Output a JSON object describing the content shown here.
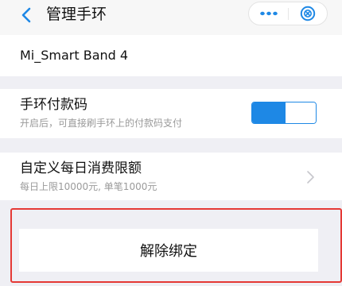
{
  "nav": {
    "title": "管理手环",
    "back_icon": "chevron-left-icon",
    "more_icon": "more-dots-icon",
    "close_icon": "close-circle-icon"
  },
  "device": {
    "name": "Mi_Smart Band 4"
  },
  "payment_code": {
    "title": "手环付款码",
    "subtitle": "开启后，可直接刷手环上的付款码支付",
    "enabled": true
  },
  "spending_limit": {
    "title": "自定义每日消费限额",
    "subtitle": "每日上限10000元, 单笔1000元",
    "chevron_icon": "chevron-right-icon"
  },
  "unbind": {
    "label": "解除绑定"
  },
  "colors": {
    "accent": "#1e88e5",
    "highlight_border": "#e53935",
    "background": "#efeff4"
  }
}
